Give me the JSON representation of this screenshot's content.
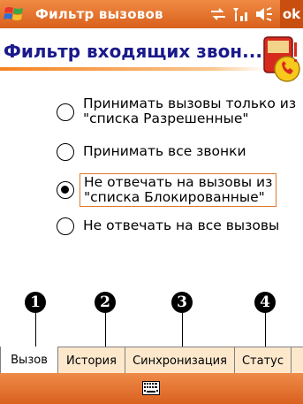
{
  "window": {
    "title": "Фильтр вызовов",
    "ok_label": "ok",
    "icons": [
      "windows-start-icon",
      "connectivity-icon",
      "signal-icon",
      "volume-icon"
    ]
  },
  "header": {
    "title": "Фильтр входящих звон..."
  },
  "options": [
    {
      "label_line1": "Принимать вызовы только из",
      "label_line2": "\"списка Разрешенные\"",
      "checked": false
    },
    {
      "label_line1": "Принимать все звонки",
      "label_line2": "",
      "checked": false
    },
    {
      "label_line1": "Не отвечать на вызовы из",
      "label_line2": "\"списка Блокированные\"",
      "checked": true
    },
    {
      "label_line1": "Не отвечать на все вызовы",
      "label_line2": "",
      "checked": false
    }
  ],
  "callouts": [
    "1",
    "2",
    "3",
    "4"
  ],
  "tabs": [
    {
      "label": "Вызов",
      "active": true
    },
    {
      "label": "История",
      "active": false
    },
    {
      "label": "Синхронизация",
      "active": false
    },
    {
      "label": "Статус",
      "active": false
    }
  ],
  "colors": {
    "title_bar": "#e37331",
    "header_text": "#1a1a8c",
    "accent_line": "#f58220",
    "tab_inactive": "#fde8cc",
    "focus_border": "#e0782c"
  },
  "bottom_bar": {
    "icon": "keyboard-icon"
  }
}
